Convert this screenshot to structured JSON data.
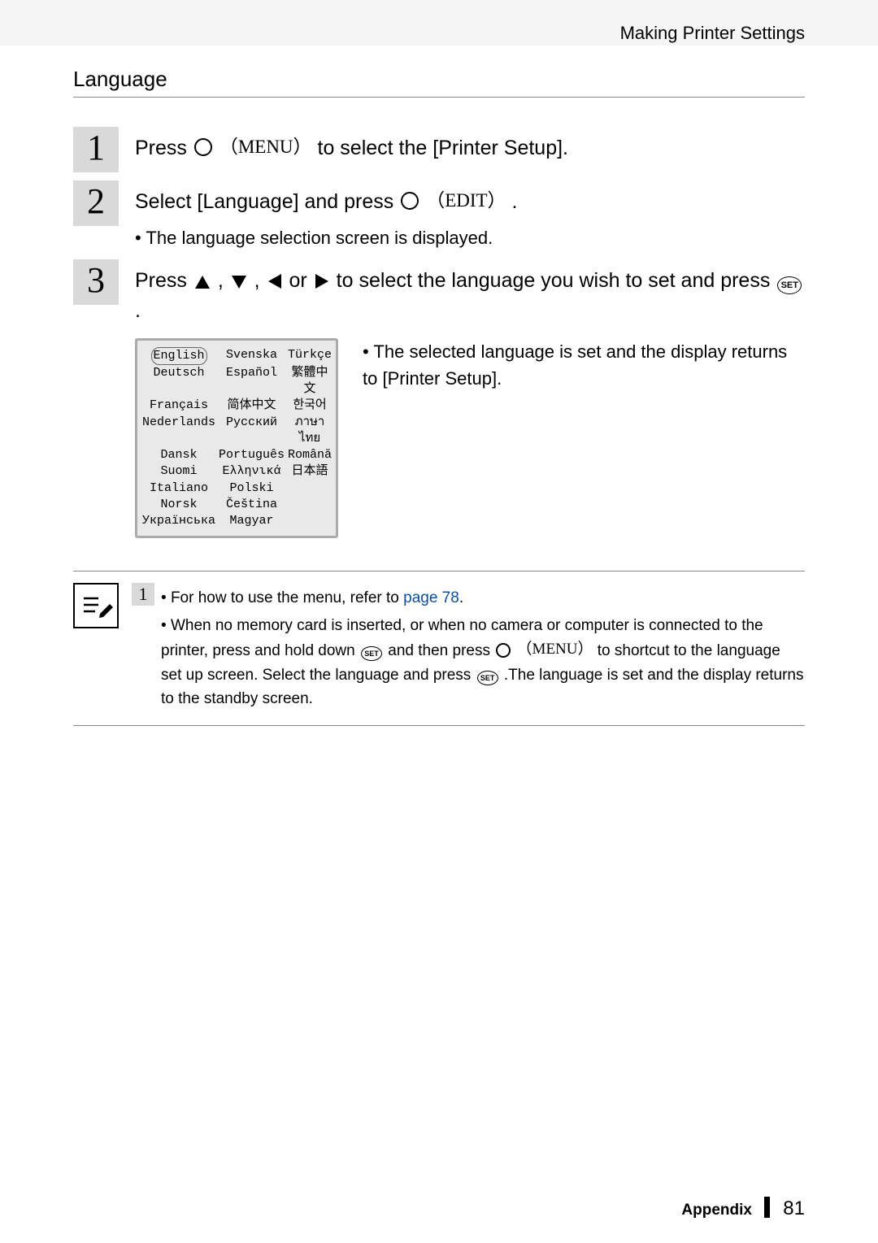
{
  "header": "Making Printer Settings",
  "section_title": "Language",
  "buttons": {
    "menu_label": "（MENU）",
    "edit_label": "（EDIT）",
    "set_label": "SET"
  },
  "step1": {
    "num": "1",
    "before": "Press ",
    "after": " to select the [Printer Setup]."
  },
  "step2": {
    "num": "2",
    "before": "Select [Language] and press ",
    "after": " .",
    "bullet": "The language selection screen is displayed."
  },
  "step3": {
    "num": "3",
    "before": "Press ",
    "mid1": " , ",
    "mid2": " , ",
    "mid3": " or ",
    "after1": " to select the language you wish to set and press ",
    "after2": " .",
    "bullet": "The selected language is set and the display returns to [Printer Setup]."
  },
  "languages": {
    "col1": [
      "English",
      "Deutsch",
      "Français",
      "Nederlands",
      "Dansk",
      "Suomi",
      "Italiano",
      "Norsk",
      "Українська"
    ],
    "col2": [
      "Svenska",
      "Español",
      "简体中文",
      "Русский",
      "Português",
      "Ελληνικά",
      "Polski",
      "Čeština",
      "Magyar"
    ],
    "col3": [
      "Türkçe",
      "繁體中文",
      "한국어",
      "ภาษาไทย",
      "Română",
      "日本語",
      "",
      "",
      ""
    ]
  },
  "note": {
    "num": "1",
    "line1_a": "For how to use the menu, refer to ",
    "line1_link": "page 78",
    "line1_b": ".",
    "line2_a": "When no memory card is inserted, or when no camera or computer is connected to the printer, press and hold down ",
    "line2_b": " and then press ",
    "line2_c": " to shortcut to the language set up screen. Select the language and press ",
    "line2_d": " .The language is set and the display returns to the standby screen."
  },
  "footer": {
    "section": "Appendix",
    "page": "81"
  }
}
